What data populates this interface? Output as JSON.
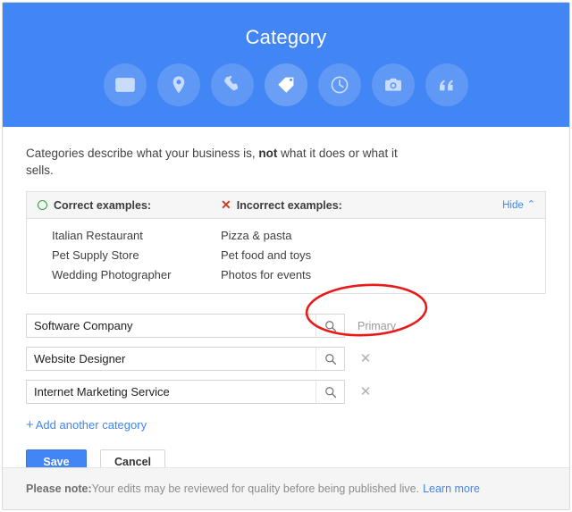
{
  "header": {
    "title": "Category",
    "icons": [
      {
        "name": "contact-card-icon",
        "active": false
      },
      {
        "name": "location-pin-icon",
        "active": false
      },
      {
        "name": "phone-icon",
        "active": false
      },
      {
        "name": "tag-icon",
        "active": true
      },
      {
        "name": "clock-icon",
        "active": false
      },
      {
        "name": "camera-icon",
        "active": false
      },
      {
        "name": "quote-icon",
        "active": false
      }
    ]
  },
  "intro": {
    "part1": "Categories describe what your business is, ",
    "emphasis": "not",
    "part2": " what it does or what it sells."
  },
  "examples": {
    "correct_header": "Correct examples:",
    "incorrect_header": "Incorrect examples:",
    "hide_label": "Hide",
    "hide_chevron": "⌃",
    "correct_mark": "O",
    "incorrect_mark": "✕",
    "rows": [
      {
        "correct": "Italian Restaurant",
        "incorrect": "Pizza & pasta"
      },
      {
        "correct": "Pet Supply Store",
        "incorrect": "Pet food and toys"
      },
      {
        "correct": "Wedding Photographer",
        "incorrect": "Photos for events"
      }
    ]
  },
  "categories": [
    {
      "value": "Software Company",
      "badge": "Primary",
      "removable": false
    },
    {
      "value": "Website Designer",
      "badge": "",
      "removable": true
    },
    {
      "value": "Internet Marketing Service",
      "badge": "",
      "removable": true
    }
  ],
  "add_link": {
    "plus": "+",
    "label": "Add another category"
  },
  "actions": {
    "save_label": "Save",
    "cancel_label": "Cancel"
  },
  "footer": {
    "note_label": "Please note:",
    "note_text": " Your edits may be reviewed for quality before being published live.",
    "learn_more": "Learn more"
  },
  "colors": {
    "brand_blue": "#4285f4",
    "annotation_red": "#e81b1b",
    "correct_green": "#2e9e3e",
    "incorrect_red": "#cc3b22"
  }
}
